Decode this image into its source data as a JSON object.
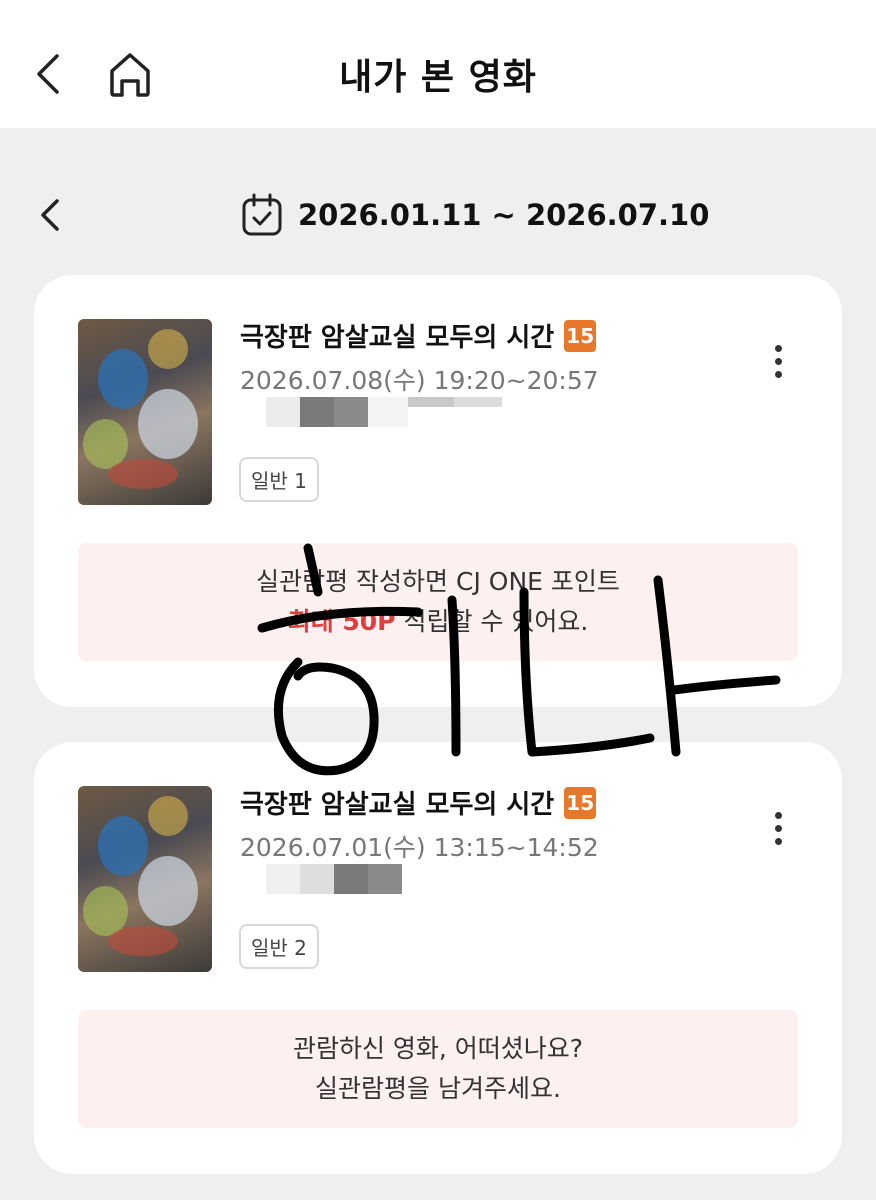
{
  "header": {
    "title": "내가 본 영화",
    "back_icon": "chevron-left-icon",
    "home_icon": "home-icon"
  },
  "date_filter": {
    "range": "2026.01.11 ~ 2026.07.10",
    "prev_icon": "chevron-left-icon",
    "calendar_icon": "calendar-check-icon"
  },
  "movies": [
    {
      "title": "극장판 암살교실 모두의 시간",
      "rating": "15",
      "showtime": "2026.07.08(수) 19:20~20:57",
      "seat_type": "일반 1",
      "promo_line1": "실관람평 작성하면 CJ ONE 포인트",
      "promo_highlight": "최대 50P",
      "promo_line2_rest": " 적립할 수 있어요."
    },
    {
      "title": "극장판 암살교실 모두의 시간",
      "rating": "15",
      "showtime": "2026.07.01(수) 13:15~14:52",
      "seat_type": "일반 2",
      "promo_line1": "관람하신 영화, 어떠셨나요?",
      "promo_line2": "실관람평을 남겨주세요."
    }
  ],
  "overlay_text": "히나",
  "colors": {
    "accent": "#e23d3d",
    "rating_badge": "#e9772a",
    "promo_bg": "#fdf0f0",
    "page_bg": "#efefef"
  }
}
